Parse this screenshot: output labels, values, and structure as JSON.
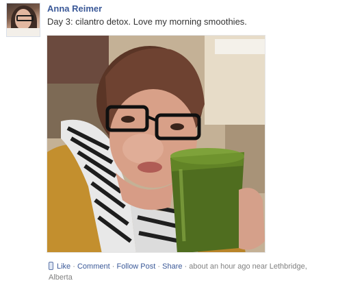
{
  "post": {
    "author": "Anna Reimer",
    "message": "Day 3: cilantro detox. Love my morning smoothies.",
    "photo_icon": "smoothie-selfie-photo",
    "mobile_icon": "mobile-phone-icon",
    "actions": {
      "like": "Like",
      "comment": "Comment",
      "follow": "Follow Post",
      "share": "Share"
    },
    "separator": "·",
    "time": "about an hour ago near Lethbridge,",
    "location_cont": "Alberta"
  },
  "colors": {
    "link": "#3b5998",
    "meta": "#808080",
    "text": "#333333"
  }
}
